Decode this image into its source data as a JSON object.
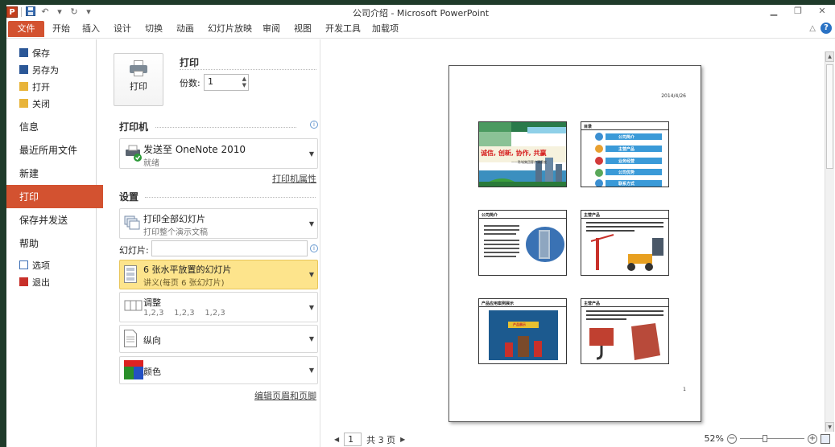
{
  "window": {
    "title": "公司介绍 - Microsoft PowerPoint"
  },
  "qat": {
    "app_icon": "P",
    "save_icon": "save-icon",
    "undo_icon": "↶",
    "redo_icon": "↻",
    "customize_icon": "▾"
  },
  "ribbon": {
    "tabs": [
      "文件",
      "开始",
      "插入",
      "设计",
      "切换",
      "动画",
      "幻灯片放映",
      "审阅",
      "视图",
      "开发工具",
      "加载项"
    ],
    "help_icon": "?"
  },
  "nav": {
    "small_items": [
      {
        "label": "保存",
        "icon": "save-icon",
        "color": "#2b5797"
      },
      {
        "label": "另存为",
        "icon": "save-as-icon",
        "color": "#2b5797"
      },
      {
        "label": "打开",
        "icon": "open-folder-icon",
        "color": "#e8b43a"
      },
      {
        "label": "关闭",
        "icon": "close-folder-icon",
        "color": "#e8b43a"
      }
    ],
    "big_items": [
      "信息",
      "最近所用文件",
      "新建",
      "打印",
      "保存并发送",
      "帮助"
    ],
    "active": "打印",
    "bottom_items": [
      {
        "label": "选项",
        "icon": "options-icon",
        "color": "#3d6fb5"
      },
      {
        "label": "退出",
        "icon": "exit-icon",
        "color": "#c8302a"
      }
    ]
  },
  "print": {
    "button_label": "打印",
    "section_title": "打印",
    "copies_label": "份数:",
    "copies_value": "1"
  },
  "printer": {
    "section_title": "打印机",
    "name": "发送至 OneNote 2010",
    "status": "就绪",
    "properties_link": "打印机属性"
  },
  "settings": {
    "section_title": "设置",
    "range_main": "打印全部幻灯片",
    "range_sub": "打印整个演示文稿",
    "slides_label": "幻灯片:",
    "slides_value": "",
    "layout_main": "6 张水平放置的幻灯片",
    "layout_sub": "讲义(每页 6 张幻灯片)",
    "collate_main": "调整",
    "collate_sub": "1,2,3    1,2,3    1,2,3",
    "orientation": "纵向",
    "color": "颜色",
    "header_footer_link": "编辑页眉和页脚"
  },
  "preview": {
    "date": "2014/4/26",
    "page_number": "1",
    "slides": [
      {
        "title": "",
        "caption": "——陈城集团客户满意度"
      },
      {
        "title": "目录",
        "items": [
          "公司简介",
          "主营产品",
          "业务经营",
          "公司优势",
          "联系方式"
        ]
      },
      {
        "title": "公司简介",
        "text": "公司成立于2002年"
      },
      {
        "title": "主营产品",
        "text": "主营产品"
      },
      {
        "title": "产品应用案例展示",
        "text": "产品展示"
      },
      {
        "title": "主营产品",
        "text": "主营产品"
      }
    ]
  },
  "pager": {
    "current": "1",
    "total": "共 3 页"
  },
  "zoom": {
    "level": "52%"
  }
}
